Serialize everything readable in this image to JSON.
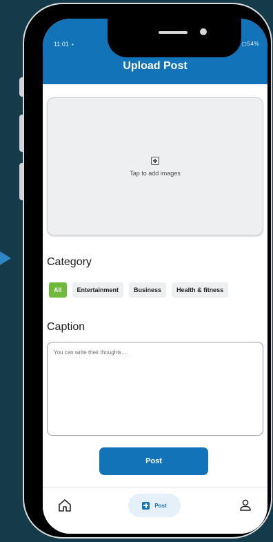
{
  "status_bar": {
    "time": "11:01",
    "notification_glyph": "•",
    "icons_text": "✉ ⁂ .ıl ▢54%"
  },
  "app_bar": {
    "title": "Upload Post"
  },
  "upload": {
    "icon": "add-box-icon",
    "label": "Tap to add images"
  },
  "category": {
    "heading": "Category",
    "chips": [
      {
        "label": "All",
        "selected": true
      },
      {
        "label": "Entertainment",
        "selected": false
      },
      {
        "label": "Business",
        "selected": false
      },
      {
        "label": "Health & fitness",
        "selected": false
      }
    ]
  },
  "caption": {
    "heading": "Caption",
    "value": "",
    "placeholder": "You can write their thoughts...."
  },
  "actions": {
    "post_label": "Post"
  },
  "bottom_nav": {
    "home_icon": "home-icon",
    "post_label": "Post",
    "profile_icon": "user-icon"
  },
  "colors": {
    "primary": "#1273b8",
    "selected_chip": "#6fba3d",
    "background": "#153b4a",
    "chip_background": "#eeeff1"
  }
}
